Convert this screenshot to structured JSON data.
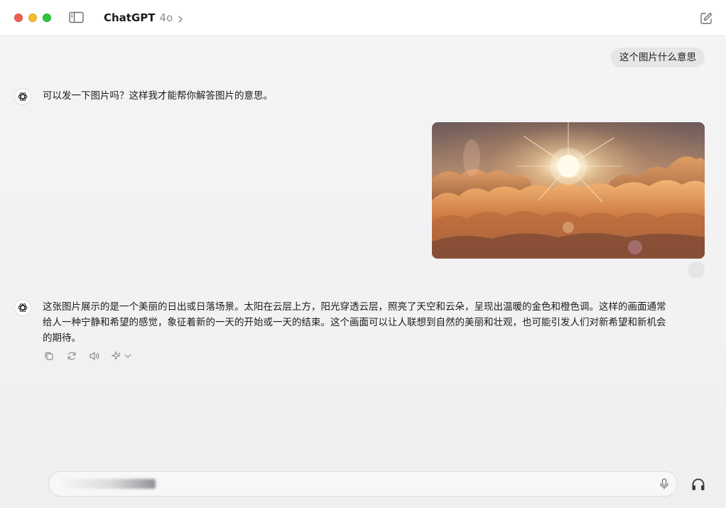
{
  "window": {
    "app_title": "ChatGPT",
    "model": "4o"
  },
  "conversation": {
    "user_message_1": "这个图片什么意思",
    "assistant_message_1": "可以发一下图片吗？这样我才能帮你解答图片的意思。",
    "user_image_1": "sunrise-over-clouds",
    "assistant_message_2": "这张图片展示的是一个美丽的日出或日落场景。太阳在云层上方，阳光穿透云层，照亮了天空和云朵，呈现出温暖的金色和橙色调。这样的画面通常给人一种宁静和希望的感觉，象征着新的一天的开始或一天的结束。这个画面可以让人联想到自然的美丽和壮观，也可能引发人们对新希望和新机会的期待。"
  },
  "message_actions": [
    "copy-icon",
    "regenerate-icon",
    "read-aloud-icon",
    "sparkle-model-icon"
  ],
  "composer": {
    "value": "",
    "placeholder": ""
  },
  "icons": {
    "sidebar": "sidebar-icon",
    "new_chat": "new-chat-icon",
    "mic": "microphone-icon",
    "voice": "headphones-icon"
  },
  "colors": {
    "traffic_close": "#ee5f57",
    "traffic_min": "#f5bd2f",
    "traffic_max": "#2fc840",
    "bubble": "#e6e6e8",
    "text": "#1c1c1e",
    "muted": "#8e8e93"
  }
}
